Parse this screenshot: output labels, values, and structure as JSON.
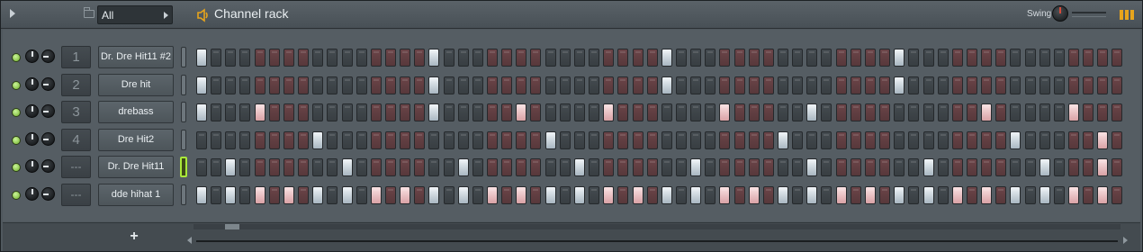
{
  "titlebar": {
    "filter_value": "All",
    "title": "Channel rack",
    "swing_label": "Swing",
    "icons": {
      "menu": "menu-arrow-icon",
      "folder": "folder-icon",
      "speaker": "speaker-icon",
      "pattern": "pattern-icon"
    },
    "accent_color": "#e7a41c"
  },
  "colors": {
    "step_on_gray": "#d7e0e7",
    "step_on_pink": "#f2c8cb",
    "step_off_gray": "#40464a",
    "step_off_pink": "#5f3d40",
    "select_active": "#a9e83a"
  },
  "channels": [
    {
      "mixer": "1",
      "name": "Dr. Dre Hit11 #2",
      "selected": false,
      "steps_on": [
        0,
        16,
        32,
        48
      ]
    },
    {
      "mixer": "2",
      "name": "Dre hit",
      "selected": false,
      "steps_on": [
        0,
        16,
        32,
        48
      ]
    },
    {
      "mixer": "3",
      "name": "drebass",
      "selected": false,
      "steps_on": [
        0,
        4,
        16,
        22,
        28,
        36,
        42,
        54,
        60
      ]
    },
    {
      "mixer": "4",
      "name": "Dre Hit2",
      "selected": false,
      "steps_on": [
        8,
        24,
        40,
        56,
        62
      ]
    },
    {
      "mixer": "---",
      "name": "Dr. Dre Hit11",
      "selected": true,
      "steps_on": [
        2,
        10,
        18,
        26,
        34,
        42,
        50,
        58,
        62
      ]
    },
    {
      "mixer": "---",
      "name": "dde hihat 1",
      "selected": false,
      "steps_on": [
        0,
        2,
        4,
        6,
        8,
        10,
        12,
        14,
        16,
        18,
        20,
        22,
        24,
        26,
        28,
        30,
        32,
        34,
        36,
        38,
        40,
        42,
        44,
        46,
        48,
        50,
        52,
        54,
        56,
        58,
        60,
        62
      ]
    }
  ],
  "bottom": {
    "add_channel": "+"
  },
  "step_count": 64
}
